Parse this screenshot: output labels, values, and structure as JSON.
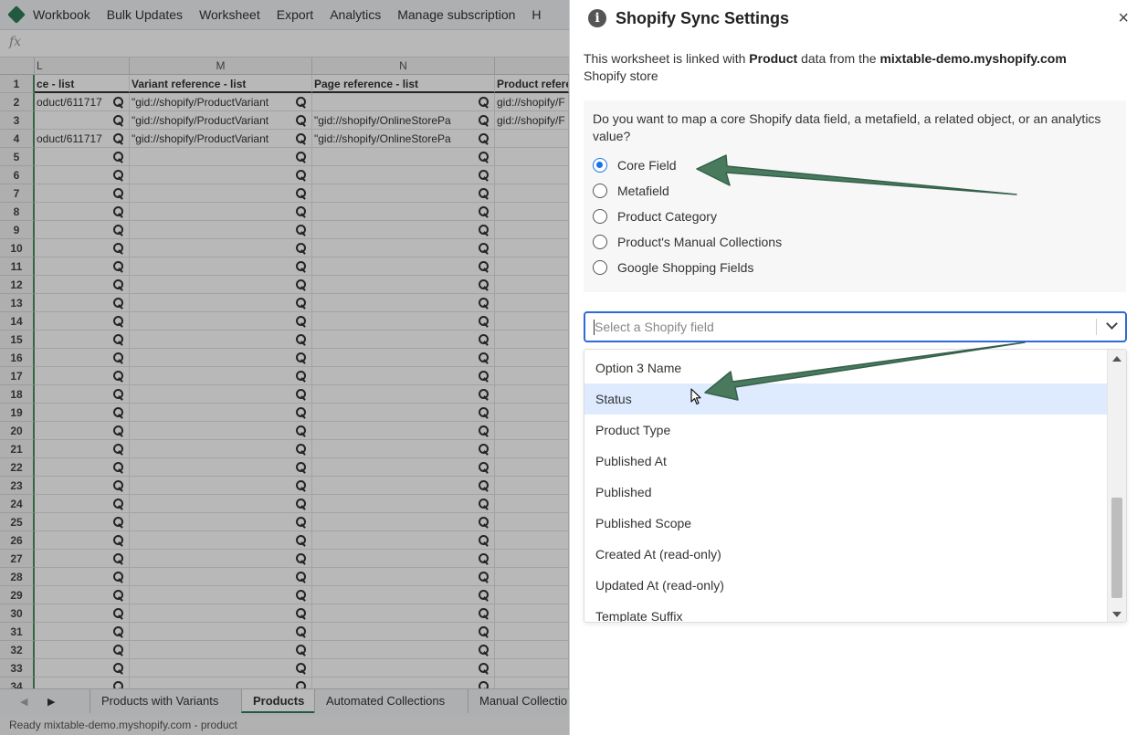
{
  "menubar": {
    "items": [
      "Workbook",
      "Bulk Updates",
      "Worksheet",
      "Export",
      "Analytics",
      "Manage subscription",
      "H"
    ]
  },
  "formula_bar": {
    "fx_label": "fx"
  },
  "grid": {
    "columns": [
      "L",
      "M",
      "N"
    ],
    "column_headers": [
      "ce - list",
      "Variant reference - list",
      "Page reference - list",
      "Product refere"
    ],
    "rows": [
      [
        "oduct/611717",
        "\"gid://shopify/ProductVariant",
        "",
        "gid://shopify/F"
      ],
      [
        "",
        "\"gid://shopify/ProductVariant",
        "\"gid://shopify/OnlineStorePa",
        "gid://shopify/F"
      ],
      [
        "oduct/611717",
        "\"gid://shopify/ProductVariant",
        "\"gid://shopify/OnlineStorePa",
        ""
      ]
    ],
    "row_numbers": [
      "1",
      "2",
      "3",
      "4",
      "5",
      "6",
      "7",
      "8",
      "9",
      "10",
      "11",
      "12",
      "13",
      "14",
      "15",
      "16",
      "17",
      "18",
      "19",
      "20",
      "21",
      "22",
      "23",
      "24",
      "25",
      "26",
      "27",
      "28",
      "29",
      "30",
      "31",
      "32",
      "33",
      "34"
    ]
  },
  "sheet_tabs": [
    "Products with Variants",
    "Products",
    "Automated Collections",
    "Manual Collectio"
  ],
  "active_sheet_tab": "Products",
  "status_bar": {
    "text": "Ready   mixtable-demo.myshopify.com - product"
  },
  "panel": {
    "title": "Shopify Sync Settings",
    "info_icon_glyph": "i",
    "close_glyph": "×",
    "link_prefix": "This worksheet is linked with ",
    "link_object": "Product",
    "link_middle": " data from the ",
    "link_store": "mixtable-demo.myshopify.com",
    "link_suffix": " Shopify store",
    "question": "Do you want to map a core Shopify data field, a metafield, a related object, or an analytics value?",
    "radio_options": [
      "Core Field",
      "Metafield",
      "Product Category",
      "Product's Manual Collections",
      "Google Shopping Fields"
    ],
    "selected_option": "Core Field",
    "select_placeholder": "Select a Shopify field",
    "dropdown_options": [
      "Option 3 Name",
      "Status",
      "Product Type",
      "Published At",
      "Published",
      "Published Scope",
      "Created At (read-only)",
      "Updated At (read-only)",
      "Template Suffix"
    ],
    "highlighted_option": "Status"
  },
  "colors": {
    "accent_blue": "#1a73e8",
    "select_border": "#2e6bd8",
    "highlight_bg": "#deebff",
    "annotation_arrow": "#4a7a5e"
  },
  "icons": [
    "app-logo-icon",
    "info-icon",
    "close-icon",
    "chevron-down-icon",
    "magnifier-icon",
    "mouse-cursor-icon",
    "annotation-arrow-icon"
  ]
}
